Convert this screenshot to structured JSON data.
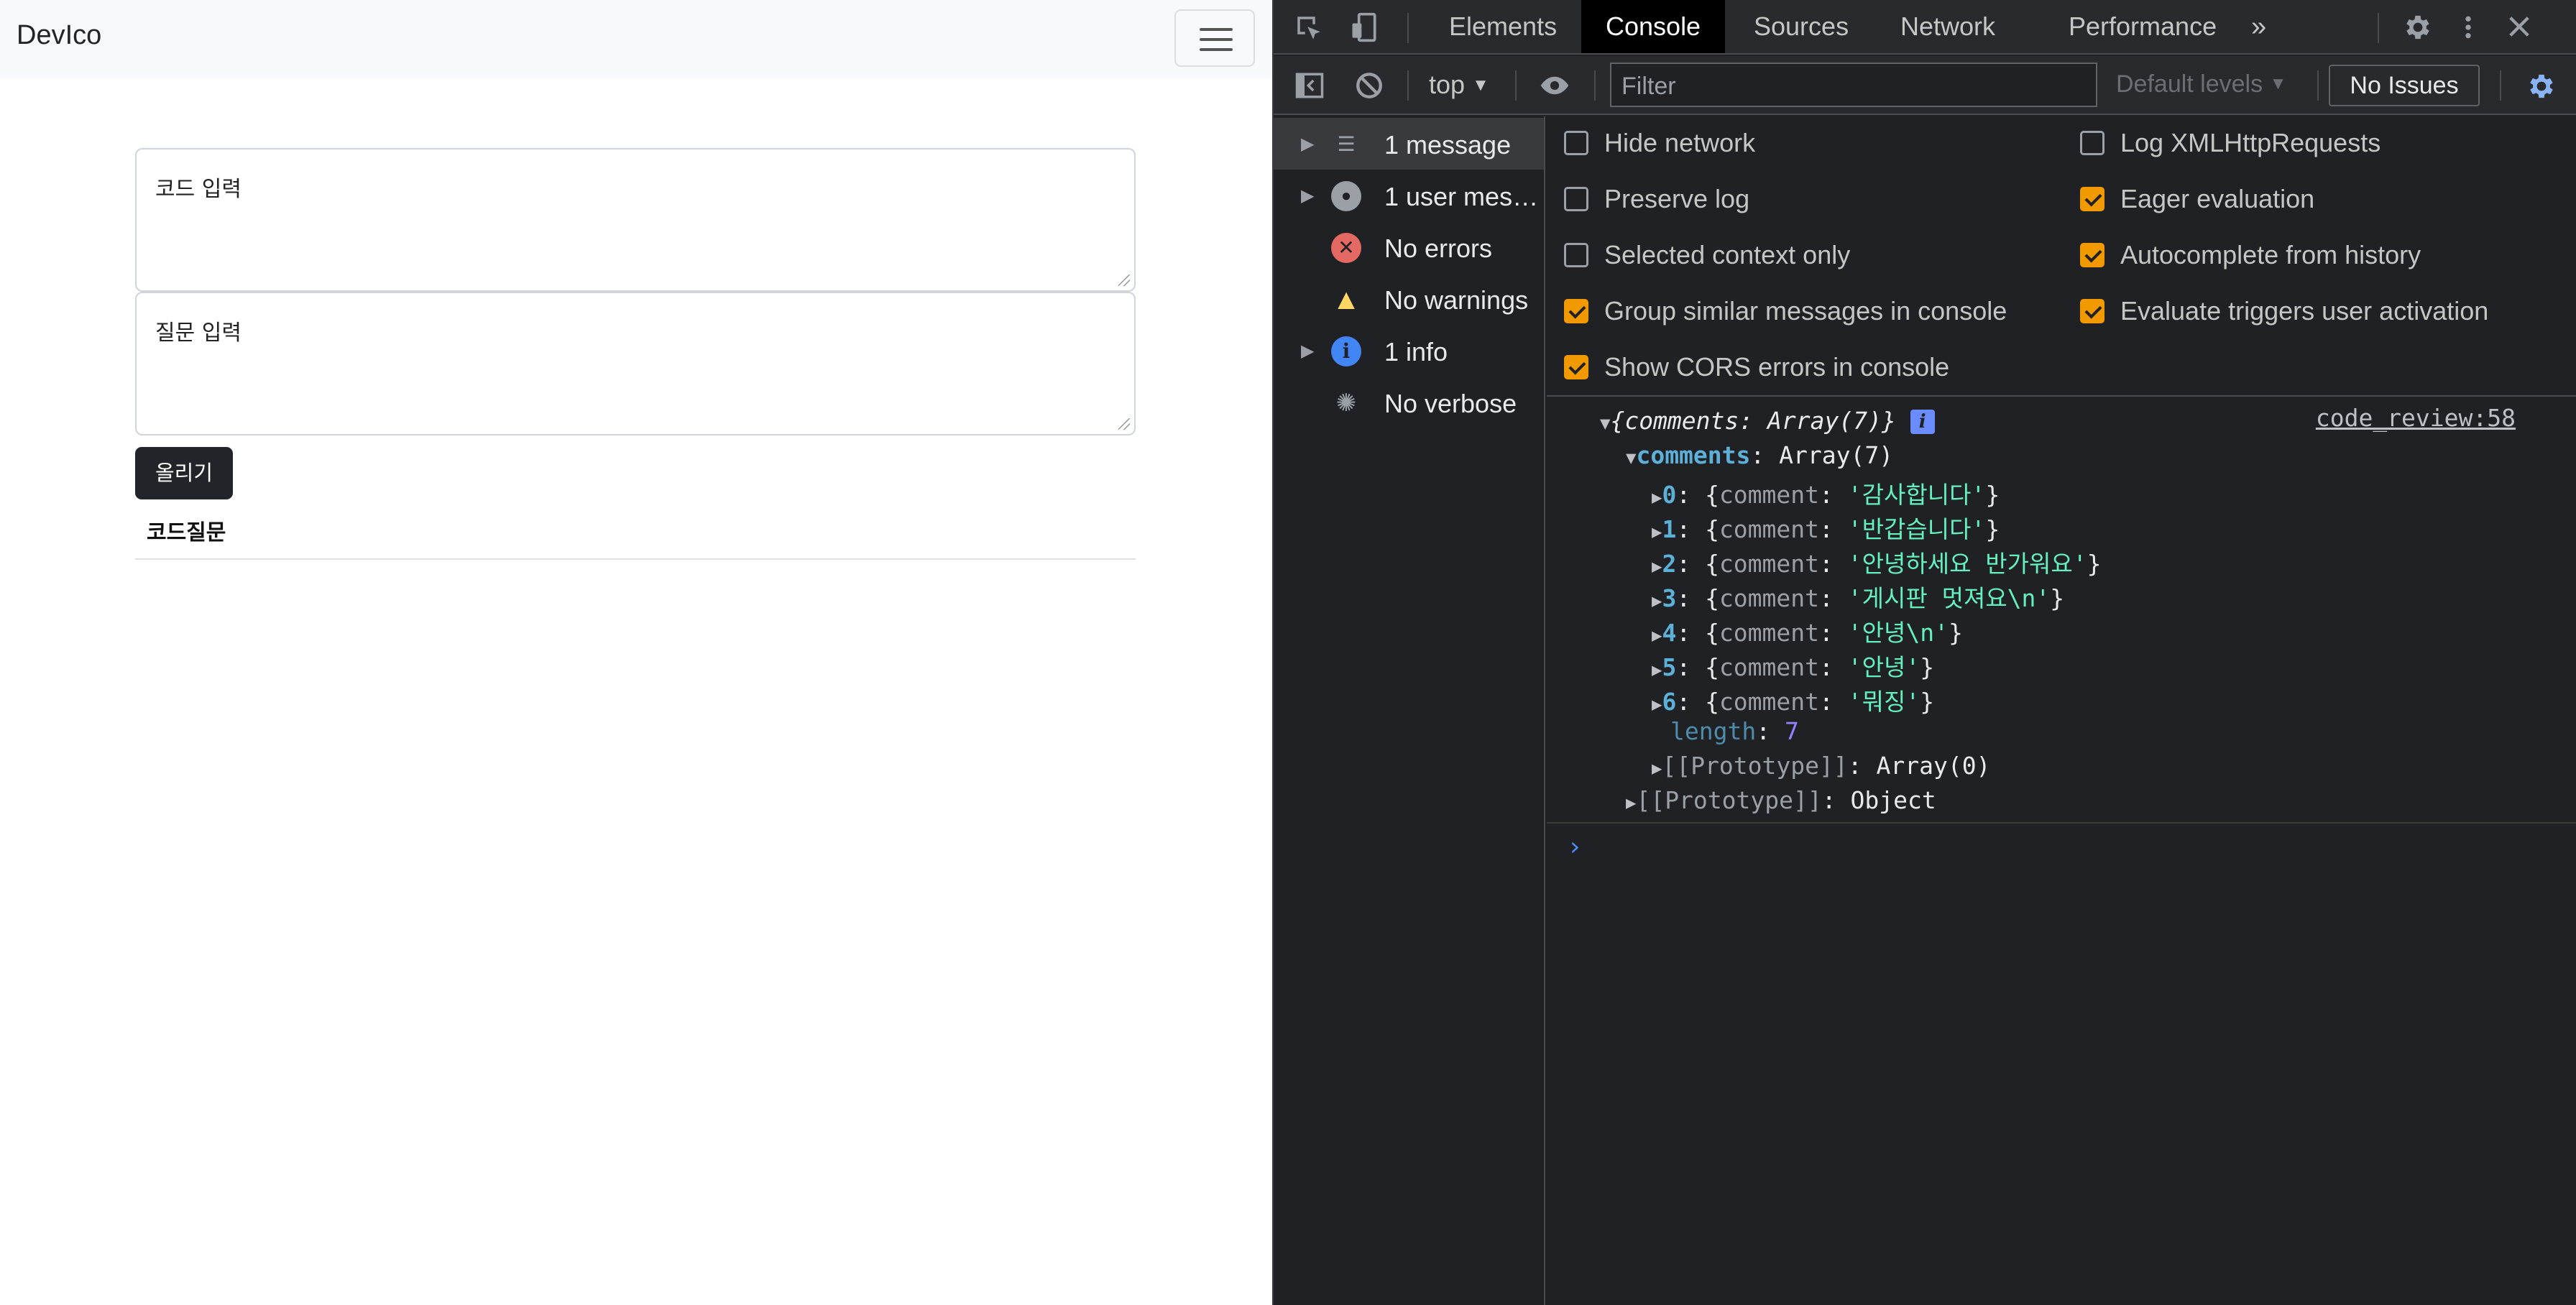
{
  "page": {
    "brand": "DevIco",
    "code_placeholder": "코드 입력",
    "question_placeholder": "질문 입력",
    "post_button": "올리기",
    "list_title": "코드질문"
  },
  "devtools": {
    "tabs": [
      "Elements",
      "Console",
      "Sources",
      "Network",
      "Performance"
    ],
    "active_tab": "Console",
    "more_tabs": "»",
    "toolbar": {
      "context": "top",
      "filter_placeholder": "Filter",
      "levels": "Default levels",
      "issues": "No Issues"
    },
    "sidebar": [
      {
        "label": "1 message",
        "icon": "list-icon",
        "expandable": true
      },
      {
        "label": "1 user mes…",
        "icon": "user-icon",
        "expandable": true
      },
      {
        "label": "No errors",
        "icon": "error-icon",
        "expandable": false
      },
      {
        "label": "No warnings",
        "icon": "warning-icon",
        "expandable": false
      },
      {
        "label": "1 info",
        "icon": "info-icon",
        "expandable": true
      },
      {
        "label": "No verbose",
        "icon": "verbose-icon",
        "expandable": false
      }
    ],
    "settings_left": [
      {
        "label": "Hide network",
        "checked": false
      },
      {
        "label": "Preserve log",
        "checked": false
      },
      {
        "label": "Selected context only",
        "checked": false
      },
      {
        "label": "Group similar messages in console",
        "checked": true
      },
      {
        "label": "Show CORS errors in console",
        "checked": true
      }
    ],
    "settings_right": [
      {
        "label": "Log XMLHttpRequests",
        "checked": false
      },
      {
        "label": "Eager evaluation",
        "checked": true
      },
      {
        "label": "Autocomplete from history",
        "checked": true
      },
      {
        "label": "Evaluate triggers user activation",
        "checked": true
      }
    ],
    "console": {
      "summary": "{comments: Array(7)}",
      "source": "code_review:58",
      "comments_key": "comments",
      "comments_type": "Array(7)",
      "items": [
        {
          "index": "0",
          "comment": "'감사합니다'"
        },
        {
          "index": "1",
          "comment": "'반갑습니다'"
        },
        {
          "index": "2",
          "comment": "'안녕하세요 반가워요'"
        },
        {
          "index": "3",
          "comment": "'게시판 멋져요\\n'"
        },
        {
          "index": "4",
          "comment": "'안녕\\n'"
        },
        {
          "index": "5",
          "comment": "'안녕'"
        },
        {
          "index": "6",
          "comment": "'뭐징'"
        }
      ],
      "length_key": "length",
      "length_value": "7",
      "proto_inner": "[[Prototype]]",
      "proto_inner_value": "Array(0)",
      "proto_outer": "[[Prototype]]",
      "proto_outer_value": "Object"
    }
  },
  "colors": {
    "checkbox_on": "#f29900",
    "active_tab_bg": "#000000",
    "console_string": "#5cd5fb",
    "console_key": "#5db0d7"
  }
}
